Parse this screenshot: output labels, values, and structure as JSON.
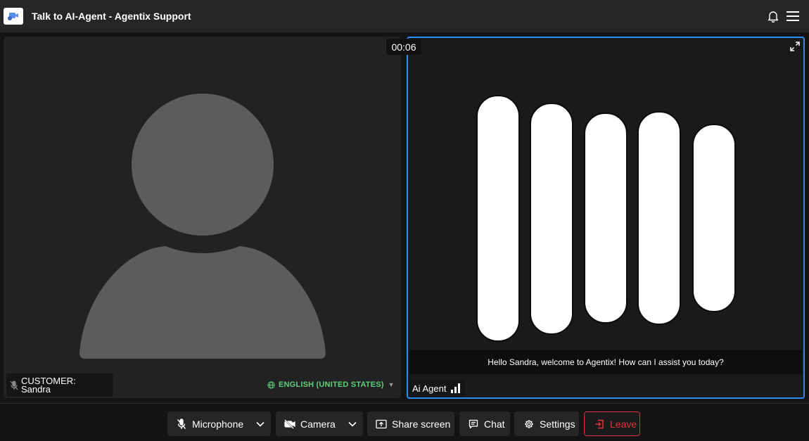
{
  "header": {
    "title": "Talk to AI-Agent - Agentix Support",
    "icons": [
      "app-logo-icon",
      "bell-icon",
      "hamburger-menu-icon"
    ]
  },
  "timer": "00:06",
  "customer_tile": {
    "label_line1": "CUSTOMER:",
    "label_line2": "Sandra",
    "mic_icon": "mic-off-icon",
    "language": "ENGLISH (UNITED STATES)",
    "language_icon": "globe-icon"
  },
  "agent_tile": {
    "caption": "Hello Sandra, welcome to Agentix! How can I assist you today?",
    "name": "Ai Agent",
    "signal_icon": "signal-bars-icon",
    "expand_icon": "expand-icon",
    "accent_color": "#2f8cf5"
  },
  "toolbar": {
    "microphone_label": "Microphone",
    "camera_label": "Camera",
    "share_label": "Share screen",
    "chat_label": "Chat",
    "settings_label": "Settings",
    "leave_label": "Leave",
    "leave_color": "#e2323e"
  }
}
